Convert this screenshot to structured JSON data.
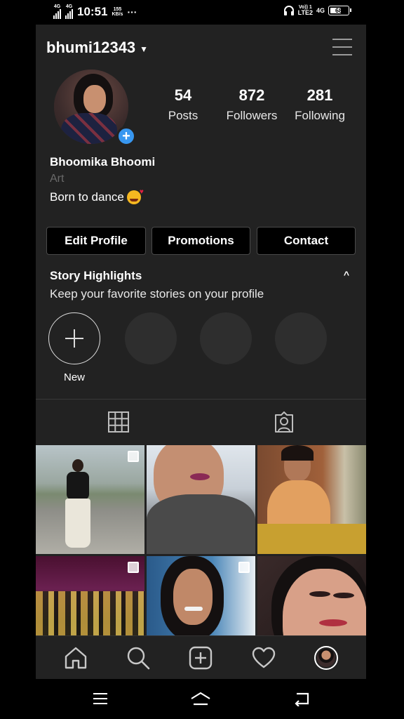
{
  "status_bar": {
    "signal1": "4G",
    "signal2": "4G",
    "time": "10:51",
    "speed_value": "155",
    "speed_unit": "KB/s",
    "more": "···",
    "volte_line1": "Vo)) 1",
    "volte_line2": "LTE2",
    "net_right": "4G",
    "battery": "68",
    "battery_level": 0.68
  },
  "profile": {
    "username": "bhumi12343",
    "full_name": "Bhoomika Bhoomi",
    "category": "Art",
    "bio": "Born to dance",
    "stats": [
      {
        "value": "54",
        "label": "Posts"
      },
      {
        "value": "872",
        "label": "Followers"
      },
      {
        "value": "281",
        "label": "Following"
      }
    ]
  },
  "buttons": {
    "edit_profile": "Edit Profile",
    "promotions": "Promotions",
    "contact": "Contact"
  },
  "highlights": {
    "title": "Story Highlights",
    "subtitle": "Keep your favorite stories on your profile",
    "new_label": "New"
  },
  "tabs": [
    {
      "icon": "grid-icon"
    },
    {
      "icon": "tagged-person-icon"
    }
  ],
  "posts": [
    {
      "desc": "woman on road",
      "multi": true
    },
    {
      "desc": "selfie",
      "multi": false
    },
    {
      "desc": "orange saree",
      "multi": false
    },
    {
      "desc": "group on stage",
      "multi": true
    },
    {
      "desc": "smiling portrait",
      "multi": true
    },
    {
      "desc": "close-up face",
      "multi": false
    }
  ],
  "bottom_nav": [
    "home-icon",
    "search-icon",
    "add-post-icon",
    "heart-icon",
    "profile-avatar-icon"
  ],
  "colors": {
    "background": "#222222",
    "accent": "#3897f0",
    "muted": "#6a6a6a"
  }
}
